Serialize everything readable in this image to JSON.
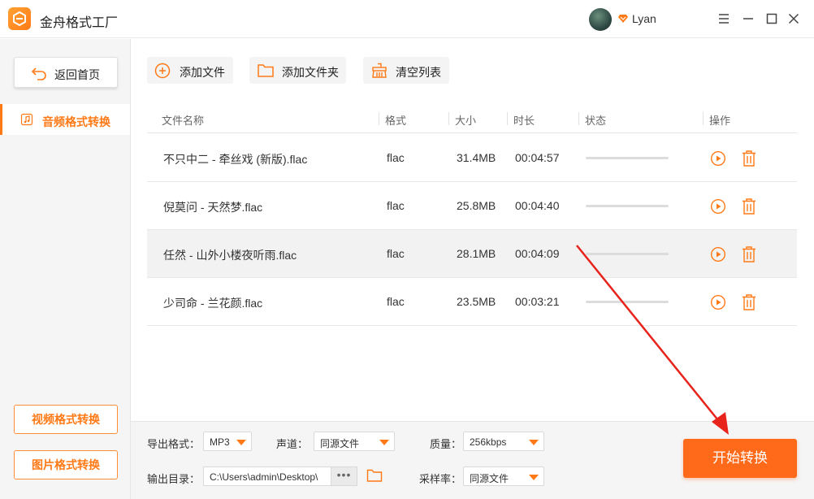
{
  "app": {
    "title": "金舟格式工厂",
    "username": "Lyan"
  },
  "sidebar": {
    "home_label": "返回首页",
    "active_item": "音频格式转换",
    "video_label": "视频格式转换",
    "image_label": "图片格式转换"
  },
  "toolbar": {
    "add_file": "添加文件",
    "add_folder": "添加文件夹",
    "clear_list": "清空列表"
  },
  "table": {
    "columns": [
      "文件名称",
      "格式",
      "大小",
      "时长",
      "状态",
      "操作"
    ],
    "rows": [
      {
        "name": "不只中二 - 牵丝戏 (新版).flac",
        "format": "flac",
        "size": "31.4MB",
        "duration": "00:04:57",
        "progress": 0
      },
      {
        "name": "倪莫问 - 天然梦.flac",
        "format": "flac",
        "size": "25.8MB",
        "duration": "00:04:40",
        "progress": 0
      },
      {
        "name": "任然 - 山外小楼夜听雨.flac",
        "format": "flac",
        "size": "28.1MB",
        "duration": "00:04:09",
        "progress": 0
      },
      {
        "name": "少司命 - 兰花颜.flac",
        "format": "flac",
        "size": "23.5MB",
        "duration": "00:03:21",
        "progress": 0
      }
    ]
  },
  "settings": {
    "export_format_label": "导出格式：",
    "export_format_value": "MP3",
    "channel_label": "声道：",
    "channel_value": "同源文件",
    "quality_label": "质量：",
    "quality_value": "256kbps",
    "output_dir_label": "输出目录：",
    "output_dir_value": "C:\\Users\\admin\\Desktop\\",
    "more_label": "•••",
    "sample_rate_label": "采样率：",
    "sample_rate_value": "同源文件"
  },
  "start_button": "开始转换",
  "colors": {
    "accent": "#ff7a17",
    "start_button": "#ff6a1a",
    "annotation_arrow": "#e8231b"
  },
  "icons": {
    "logo": "format-factory-logo",
    "vip": "diamond-icon",
    "menu": "menu-icon",
    "minimize": "minimize-icon",
    "maximize": "maximize-icon",
    "close": "close-icon",
    "home": "back-arrow-icon",
    "audio": "music-note-icon",
    "add_file": "plus-circle-icon",
    "add_folder": "folder-icon",
    "clear": "broom-icon",
    "play": "play-icon",
    "delete": "trash-icon",
    "browse": "folder-icon"
  }
}
